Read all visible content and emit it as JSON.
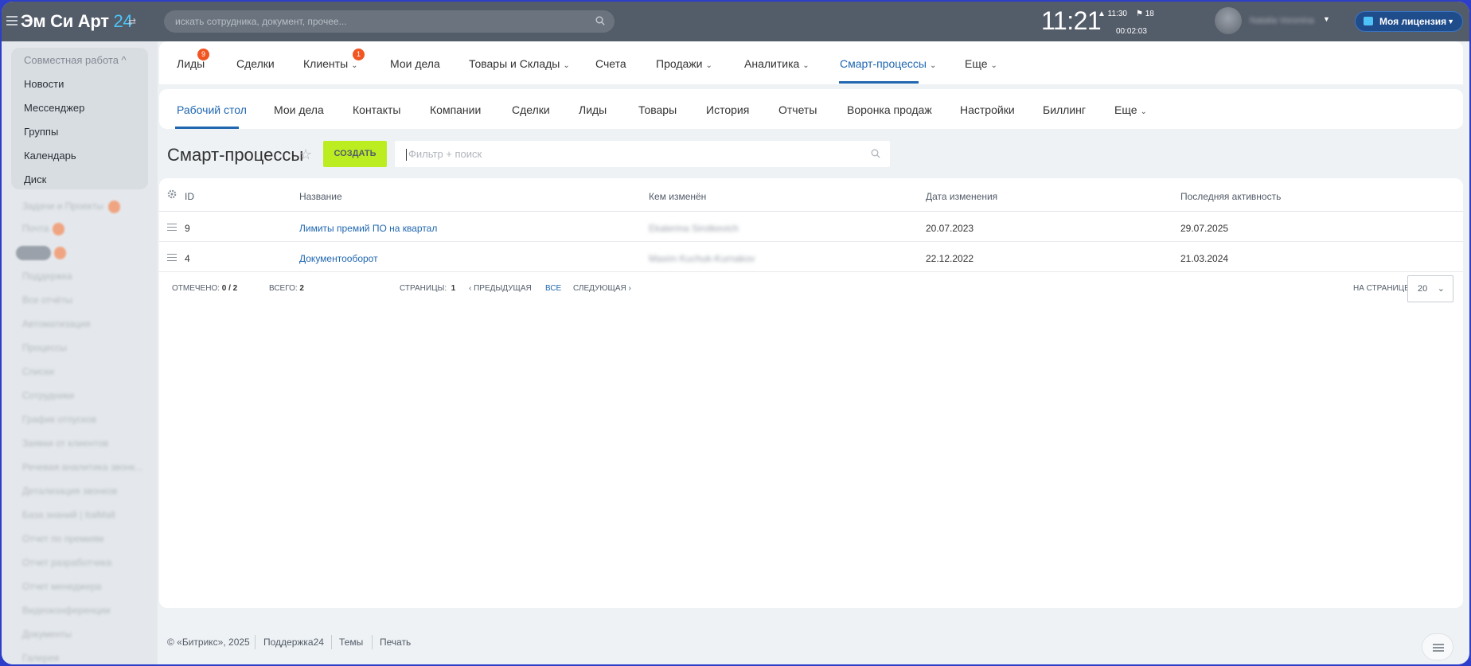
{
  "header": {
    "logo_text": "Эм Си Арт",
    "logo_num": "24",
    "search_placeholder": "искать сотрудника, документ, прочее...",
    "clock": "11:21",
    "stat_time": "▲ 11:30",
    "stat_flags": "⚑ 18",
    "timer": "00:02:03",
    "user_name": "Natalia Voronina",
    "license_label": "Моя лицензия"
  },
  "sidebar": {
    "group_title": "Совместная работа ^",
    "items": [
      "Новости",
      "Мессенджер",
      "Группы",
      "Календарь",
      "Диск"
    ],
    "faded_items": [
      "Задачи и Проекты",
      "Почта",
      "CRM",
      "Поддержка",
      "Все отчёты",
      "Автоматизация",
      "Процессы",
      "Списки",
      "Сотрудники",
      "График отпусков",
      "Заявки от клиентов",
      "Речевая аналитика звонк...",
      "Детализация звонков",
      "База знаний | ItalMall",
      "Отчет по премиям",
      "Отчет разработчика",
      "Отчет менеджера",
      "Видеоконференции",
      "Документы",
      "Галерея"
    ]
  },
  "nav": {
    "items": [
      {
        "label": "Лиды",
        "badge": "9"
      },
      {
        "label": "Сделки"
      },
      {
        "label": "Клиенты",
        "badge": "1"
      },
      {
        "label": "Мои дела"
      },
      {
        "label": "Товары и Склады"
      },
      {
        "label": "Счета"
      },
      {
        "label": "Продажи"
      },
      {
        "label": "Аналитика"
      },
      {
        "label": "Смарт-процессы"
      },
      {
        "label": "Еще"
      }
    ]
  },
  "subnav": {
    "items": [
      "Рабочий стол",
      "Мои дела",
      "Контакты",
      "Компании",
      "Сделки",
      "Лиды",
      "Товары",
      "История",
      "Отчеты",
      "Воронка продаж",
      "Настройки",
      "Биллинг",
      "Еще"
    ]
  },
  "page": {
    "title": "Смарт-процессы",
    "create_label": "СОЗДАТЬ",
    "filter_placeholder": "Фильтр + поиск"
  },
  "table": {
    "columns": [
      "ID",
      "Название",
      "Кем изменён",
      "Дата изменения",
      "Последняя активность"
    ],
    "rows": [
      {
        "id": "9",
        "name": "Лимиты премий ПО на квартал",
        "changed_by": "Ekaterina Sirotkevich",
        "date": "20.07.2023",
        "activity": "29.07.2025"
      },
      {
        "id": "4",
        "name": "Документооборот",
        "changed_by": "Maxim Kuchuk-Kurnakov",
        "date": "22.12.2022",
        "activity": "21.03.2024"
      }
    ]
  },
  "pager": {
    "selected_label": "ОТМЕЧЕНО:",
    "selected_value": "0 / 2",
    "total_label": "ВСЕГО:",
    "total_value": "2",
    "pages_label": "СТРАНИЦЫ:",
    "pages_value": "1",
    "prev": "‹ ПРЕДЫДУЩАЯ",
    "all": "ВСЕ",
    "next": "СЛЕДУЮЩАЯ ›",
    "per_page_label": "НА СТРАНИЦЕ:",
    "per_page_value": "20"
  },
  "footer": {
    "copyright": "© «Битрикс», 2025",
    "support": "Поддержка24",
    "themes": "Темы",
    "print": "Печать"
  },
  "colors": {
    "header_bg": "#535c69",
    "accent": "#2067b0",
    "create_btn": "#bbed21",
    "badge": "#f15522"
  }
}
